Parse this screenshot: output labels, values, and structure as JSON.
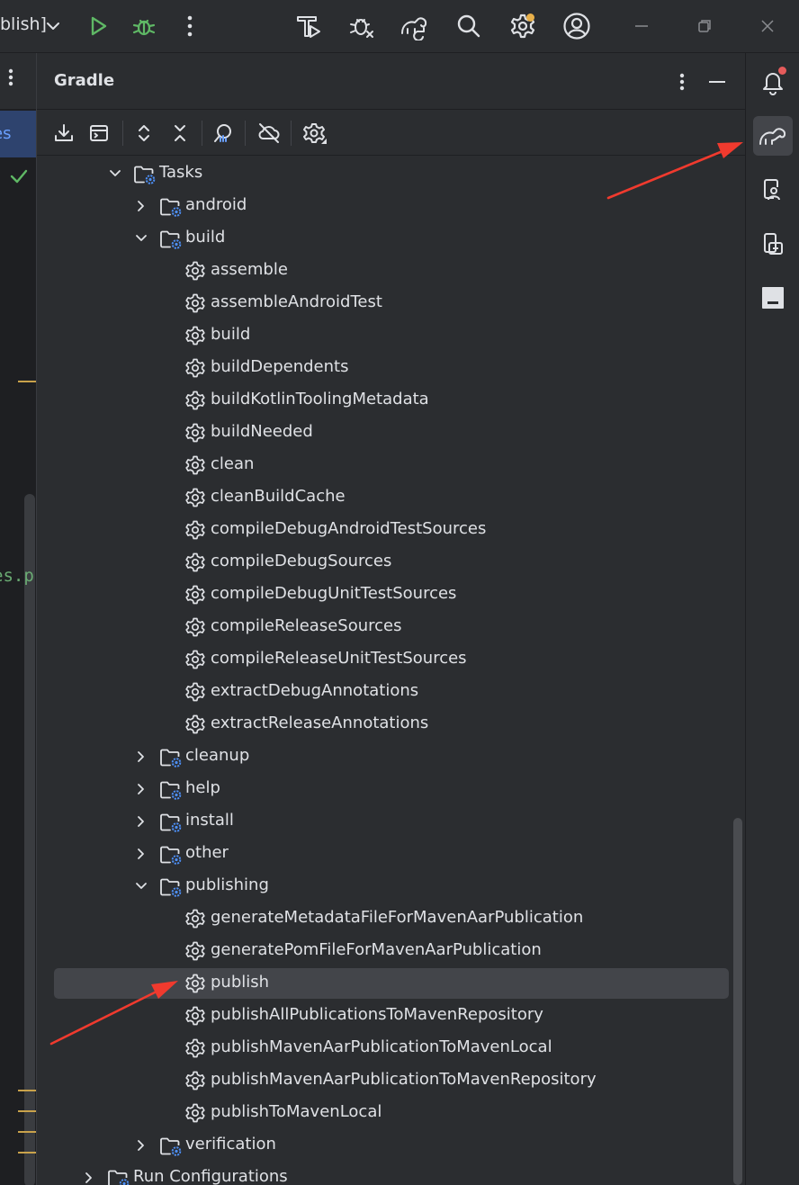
{
  "titlebar": {
    "config_text": "blish]",
    "icons": [
      "chevron-down-icon",
      "run-icon",
      "debug-icon",
      "more-icon",
      "build-icon",
      "bug-icon",
      "gradle-sync-icon",
      "search-icon",
      "settings-icon",
      "account-icon",
      "minimize-icon",
      "restore-icon",
      "close-icon"
    ]
  },
  "left_strip": {
    "tab_fragment": "es",
    "code_fragment": "es.p"
  },
  "panel": {
    "title": "Gradle",
    "toolbar": [
      "download-sources-icon",
      "run-task-icon",
      "expand-all-icon",
      "collapse-all-icon",
      "analyze-dependencies-icon",
      "offline-mode-icon",
      "gradle-settings-icon"
    ]
  },
  "tree": {
    "tasks": "Tasks",
    "android": "android",
    "build_group": "build",
    "build_tasks": [
      "assemble",
      "assembleAndroidTest",
      "build",
      "buildDependents",
      "buildKotlinToolingMetadata",
      "buildNeeded",
      "clean",
      "cleanBuildCache",
      "compileDebugAndroidTestSources",
      "compileDebugSources",
      "compileDebugUnitTestSources",
      "compileReleaseSources",
      "compileReleaseUnitTestSources",
      "extractDebugAnnotations",
      "extractReleaseAnnotations"
    ],
    "groups_after": [
      "cleanup",
      "help",
      "install",
      "other"
    ],
    "publishing_group": "publishing",
    "publishing_tasks": [
      "generateMetadataFileForMavenAarPublication",
      "generatePomFileForMavenAarPublication",
      "publish",
      "publishAllPublicationsToMavenRepository",
      "publishMavenAarPublicationToMavenLocal",
      "publishMavenAarPublicationToMavenRepository",
      "publishToMavenLocal"
    ],
    "selected_task": "publish",
    "verification": "verification",
    "run_configurations": "Run Configurations"
  },
  "right_bar": {
    "icons": [
      "notifications-icon",
      "gradle-icon",
      "device-manager-icon",
      "running-devices-icon",
      "terminal-icon"
    ],
    "active": "gradle-icon"
  },
  "colors": {
    "background": "#2b2d30",
    "selection": "#43454a",
    "folder_badge": "#4d8ff5",
    "run_green": "#5fb865",
    "annotation_red": "#f03a2e"
  }
}
